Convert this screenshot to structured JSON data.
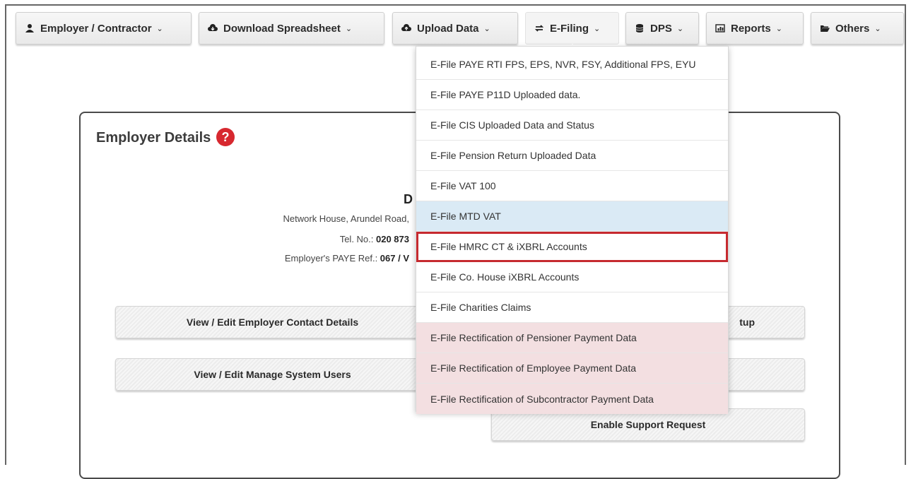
{
  "nav": {
    "employer": "Employer / Contractor",
    "download": "Download Spreadsheet",
    "upload": "Upload Data",
    "efiling": "E-Filing",
    "dps": "DPS",
    "reports": "Reports",
    "others": "Others",
    "caret": "⌄"
  },
  "panel": {
    "title": "Employer Details",
    "help": "?",
    "employer_name_initial": "D",
    "address": "Network House, Arundel Road,",
    "tel_label": "Tel. No.: ",
    "tel_value": "020 873",
    "paye_label": "Employer's PAYE Ref.: ",
    "paye_value": "067 / V"
  },
  "actions": {
    "contact": "View / Edit Employer Contact Details",
    "users": "View / Edit Manage System Users",
    "setup_partial": "tup",
    "support": "Enable Support Request"
  },
  "efiling_menu": [
    "E-File PAYE RTI FPS, EPS, NVR, FSY, Additional FPS, EYU",
    "E-File PAYE P11D Uploaded data.",
    "E-File CIS Uploaded Data and Status",
    "E-File Pension Return Uploaded Data",
    "E-File VAT 100",
    "E-File MTD VAT",
    "E-File HMRC CT & iXBRL Accounts",
    "E-File Co. House iXBRL Accounts",
    "E-File Charities Claims",
    "E-File Rectification of Pensioner Payment Data",
    "E-File Rectification of Employee Payment Data",
    "E-File Rectification of Subcontractor Payment Data"
  ],
  "colors": {
    "accent_red": "#c62a2f",
    "hover_blue": "#daeaf5",
    "pink_row": "#f3dfe1"
  }
}
